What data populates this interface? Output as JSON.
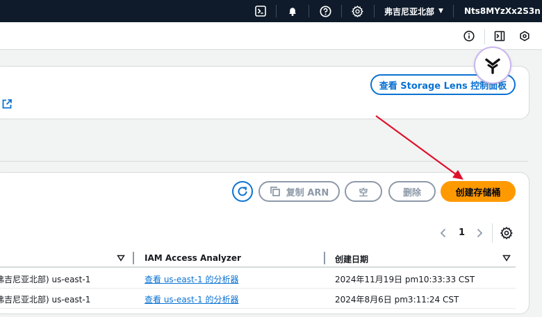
{
  "topnav": {
    "region": "弗吉尼亚北部",
    "account": "Nts8MYzXx2S3n"
  },
  "storage_lens": {
    "button_label": "查看 Storage Lens 控制面板"
  },
  "buckets": {
    "toolbar": {
      "copy_arn_label": "复制 ARN",
      "empty_label": "空",
      "delete_label": "删除",
      "create_label": "创建存储桶"
    },
    "pagination": {
      "current_page": "1"
    },
    "columns": {
      "iam_analyzer": "IAM Access Analyzer",
      "created": "创建日期"
    },
    "rows": [
      {
        "region": "弗吉尼亚北部) us-east-1",
        "analyzer_link": "查看 us-east-1 的分析器",
        "created": "2024年11月19日 pm10:33:33 CST"
      },
      {
        "region": "弗吉尼亚北部) us-east-1",
        "analyzer_link": "查看 us-east-1 的分析器",
        "created": "2024年8月6日 pm3:11:24 CST"
      }
    ]
  },
  "colors": {
    "nav_bg": "#0f1b2a",
    "link_blue": "#0972d3",
    "primary_orange": "#ff9900",
    "annotation_red": "#e0102a"
  },
  "icons": [
    "cloudshell-icon",
    "bell-icon",
    "help-icon",
    "gear-icon",
    "info-icon",
    "panel-icon",
    "hexagon-icon",
    "external-link-icon",
    "refresh-icon",
    "copy-icon",
    "chevron-left-icon",
    "chevron-right-icon",
    "settings-icon",
    "sort-down-icon"
  ]
}
